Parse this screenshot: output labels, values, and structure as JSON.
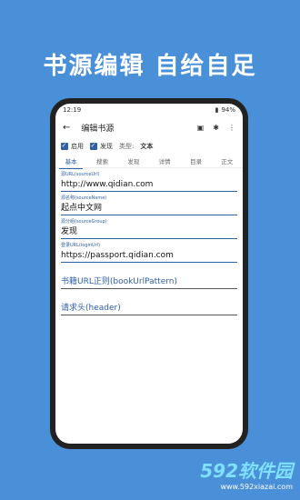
{
  "banner": {
    "title": "书源编辑  自给自足"
  },
  "status": {
    "time": "12:19",
    "battery": "94%"
  },
  "topbar": {
    "back": "←",
    "title": "编辑书源",
    "icon1": "▣",
    "icon2": "✱",
    "icon3": "⋮"
  },
  "typebar": {
    "enabled_label": "启用",
    "discover_label": "发现",
    "type_label": "类型:",
    "type_value": "文本"
  },
  "tabs": [
    "基本",
    "搜索",
    "发现",
    "详情",
    "目录",
    "正文"
  ],
  "fields": [
    {
      "label": "源URL(sourceUrl)",
      "value": "http://www.qidian.com"
    },
    {
      "label": "源名称(sourceName)",
      "value": "起点中文网"
    },
    {
      "label": "源分组(sourceGroup)",
      "value": "发现"
    },
    {
      "label": "登录URL(loginUrl)",
      "value": "https://passport.qidian.com"
    }
  ],
  "placeholders": [
    {
      "label": "书籍URL正则(bookUrlPattern)"
    },
    {
      "label": "请求头(header)"
    }
  ],
  "watermark": {
    "brand": "592软件园",
    "url": "www.592xiazai.com"
  }
}
